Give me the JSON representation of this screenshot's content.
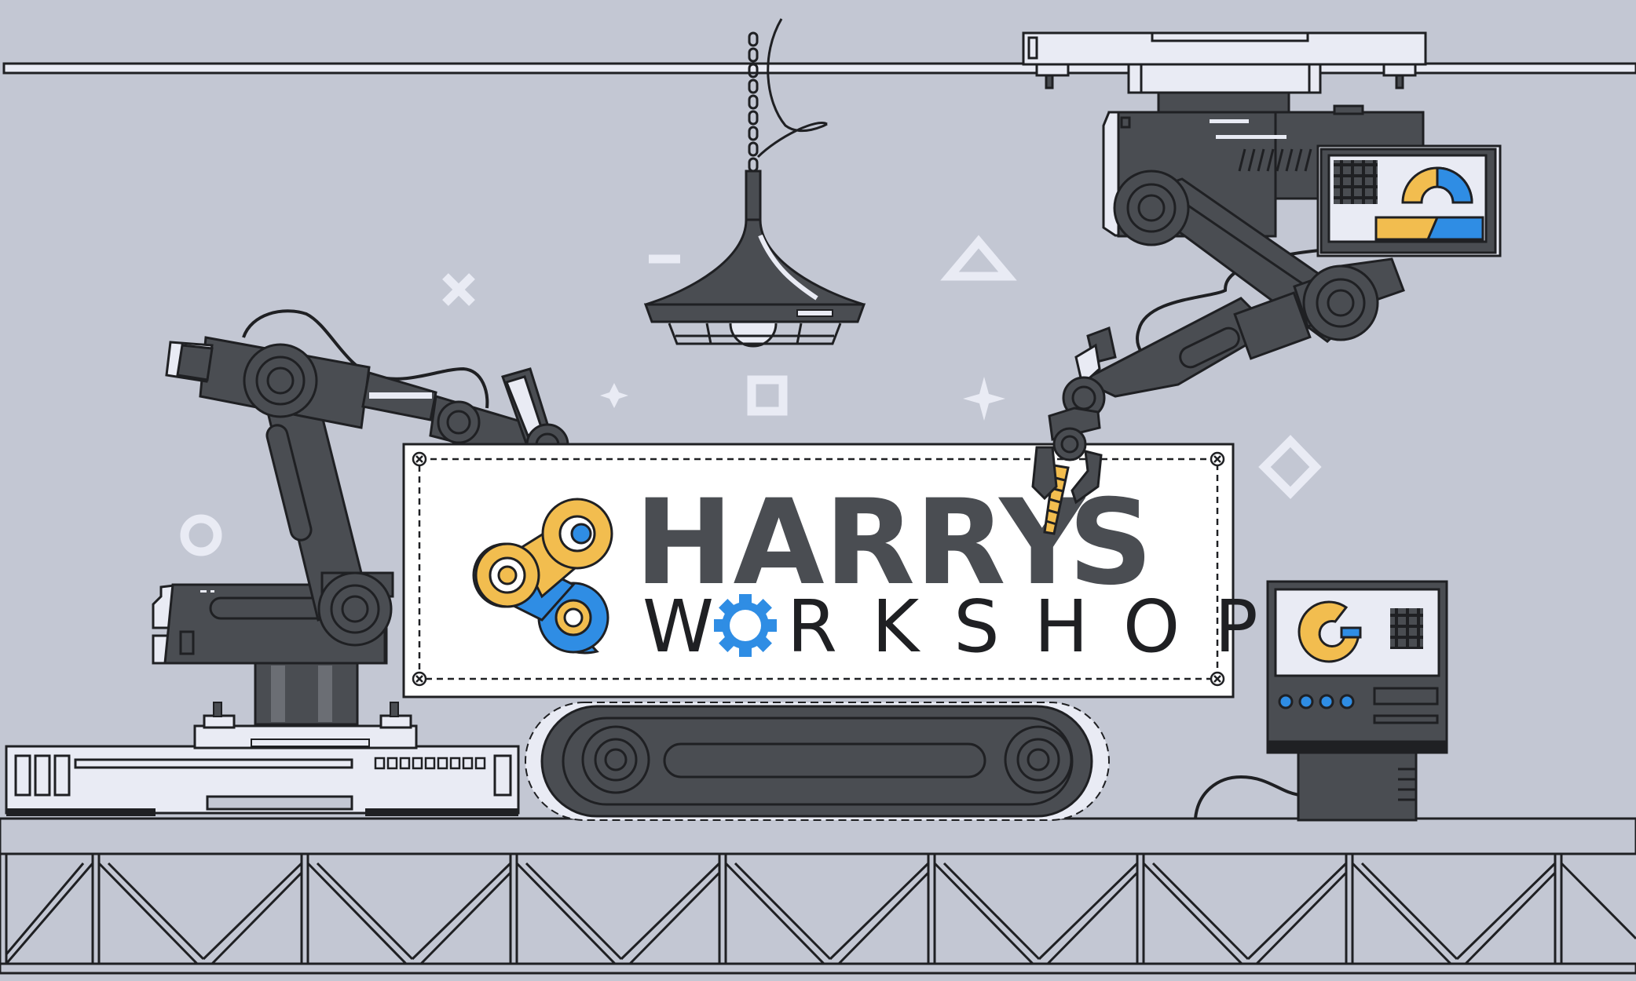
{
  "banner": {
    "title_part1": "HARRY",
    "title_part2": "S",
    "subtitle_part1": "W",
    "subtitle_part2": "RKSHOP"
  },
  "colors": {
    "background": "#c3c7d3",
    "dark_metal": "#4a4d52",
    "outline": "#1f2023",
    "accent_yellow": "#f2bd4f",
    "accent_blue": "#2f8de4",
    "light_panel": "#e9ebf4"
  },
  "icons": [
    "x-mark-icon",
    "triangle-icon",
    "square-icon",
    "circle-icon",
    "diamond-icon",
    "sparkle-icon",
    "minus-icon",
    "gear-icon",
    "chain-link-logo-icon"
  ]
}
